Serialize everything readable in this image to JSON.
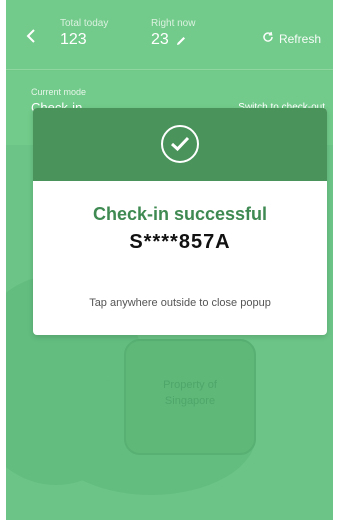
{
  "header": {
    "total_label": "Total today",
    "total_value": "123",
    "now_label": "Right now",
    "now_value": "23",
    "refresh_label": "Refresh",
    "back_icon": "chevron-left-icon",
    "edit_icon": "pencil-icon",
    "refresh_icon": "refresh-icon"
  },
  "mode": {
    "label": "Current mode",
    "value": "Check-in",
    "switch": "Switch to check-out"
  },
  "camera": {
    "card_text_line1": "Property of",
    "card_text_line2": "Singapore"
  },
  "modal": {
    "icon": "check-circle-icon",
    "title": "Check-in successful",
    "id": "S****857A",
    "hint": "Tap anywhere outside to close popup"
  },
  "colors": {
    "overlay_green": "#70c987",
    "modal_header": "#4a935b",
    "title_green": "#3f8a52"
  }
}
